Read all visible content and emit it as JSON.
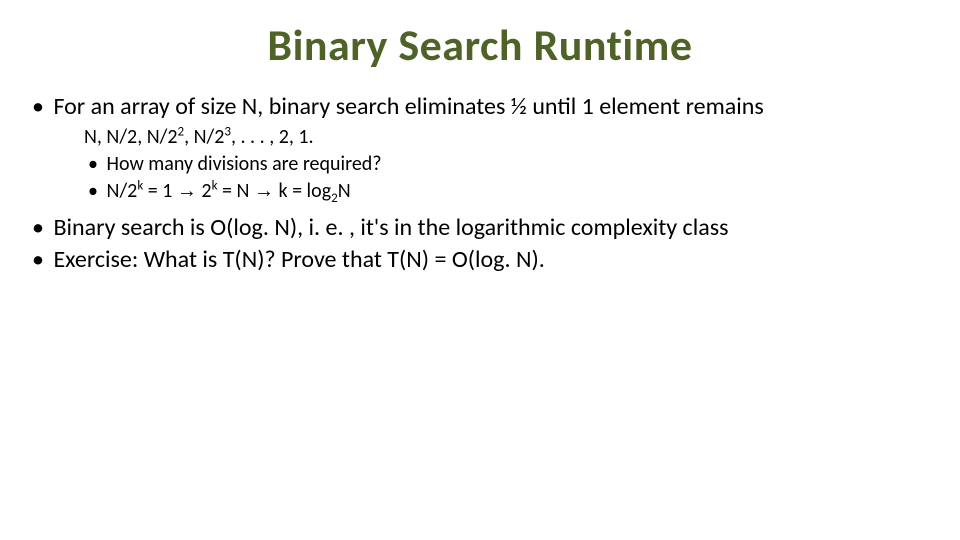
{
  "title": "Binary Search Runtime",
  "bullets": {
    "b1": "For an array of size N, binary search eliminates ½ until 1 element remains",
    "b1_sub_plain": "N, N/2, N/2², N/2³, . . . , 2, 1.",
    "b1_sub_b1": "How many divisions are required?",
    "b1_sub_b2_part1": "N/2",
    "b1_sub_b2_sup1": "k",
    "b1_sub_b2_part2": " = 1 ",
    "b1_sub_b2_arrow1": "→",
    "b1_sub_b2_part3": " 2",
    "b1_sub_b2_sup2": "k",
    "b1_sub_b2_part4": " = N ",
    "b1_sub_b2_arrow2": "→",
    "b1_sub_b2_part5": " k = log",
    "b1_sub_b2_sub": "2",
    "b1_sub_b2_part6": "N",
    "b2": "Binary search is O(log. N), i. e. , it's in the logarithmic complexity class",
    "b3": "Exercise: What is T(N)? Prove that T(N) = O(log. N)."
  }
}
